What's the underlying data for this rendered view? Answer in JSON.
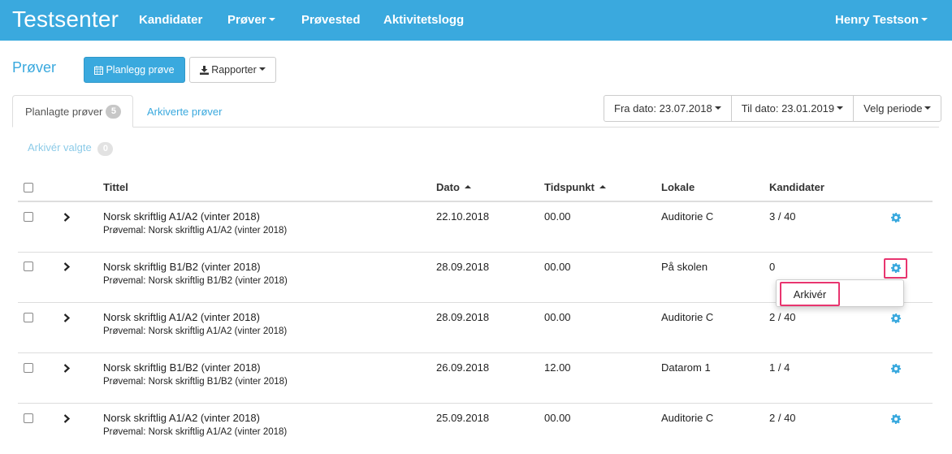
{
  "navbar": {
    "brand": "Testsenter",
    "items": [
      "Kandidater",
      "Prøver",
      "Prøvested",
      "Aktivitetslogg"
    ],
    "user": "Henry Testson"
  },
  "page": {
    "title": "Prøver",
    "plan_button": "Planlegg prøve",
    "report_button": "Rapporter"
  },
  "tabs": {
    "planned_label": "Planlagte prøver",
    "planned_count": "5",
    "archived_label": "Arkiverte prøver"
  },
  "filters": {
    "from": "Fra dato: 23.07.2018",
    "to": "Til dato: 23.01.2019",
    "period": "Velg periode"
  },
  "archive_selected": {
    "label": "Arkivér valgte",
    "count": "0"
  },
  "table": {
    "headers": {
      "title": "Tittel",
      "date": "Dato",
      "time": "Tidspunkt",
      "room": "Lokale",
      "candidates": "Kandidater"
    },
    "rows": [
      {
        "title": "Norsk skriftlig A1/A2 (vinter 2018)",
        "template": "Prøvemal: Norsk skriftlig A1/A2 (vinter 2018)",
        "date": "22.10.2018",
        "time": "00.00",
        "room": "Auditorie C",
        "candidates": "3 / 40"
      },
      {
        "title": "Norsk skriftlig B1/B2 (vinter 2018)",
        "template": "Prøvemal: Norsk skriftlig B1/B2 (vinter 2018)",
        "date": "28.09.2018",
        "time": "00.00",
        "room": "På skolen",
        "candidates": "0"
      },
      {
        "title": "Norsk skriftlig A1/A2 (vinter 2018)",
        "template": "Prøvemal: Norsk skriftlig A1/A2 (vinter 2018)",
        "date": "28.09.2018",
        "time": "00.00",
        "room": "Auditorie C",
        "candidates": "2 / 40"
      },
      {
        "title": "Norsk skriftlig B1/B2 (vinter 2018)",
        "template": "Prøvemal: Norsk skriftlig B1/B2 (vinter 2018)",
        "date": "26.09.2018",
        "time": "12.00",
        "room": "Datarom 1",
        "candidates": "1 / 4"
      },
      {
        "title": "Norsk skriftlig A1/A2 (vinter 2018)",
        "template": "Prøvemal: Norsk skriftlig A1/A2 (vinter 2018)",
        "date": "25.09.2018",
        "time": "00.00",
        "room": "Auditorie C",
        "candidates": "2 / 40"
      }
    ]
  },
  "row_menu": {
    "archive": "Arkivér"
  },
  "colors": {
    "primary": "#3aa9de",
    "highlight": "#e8356f"
  }
}
